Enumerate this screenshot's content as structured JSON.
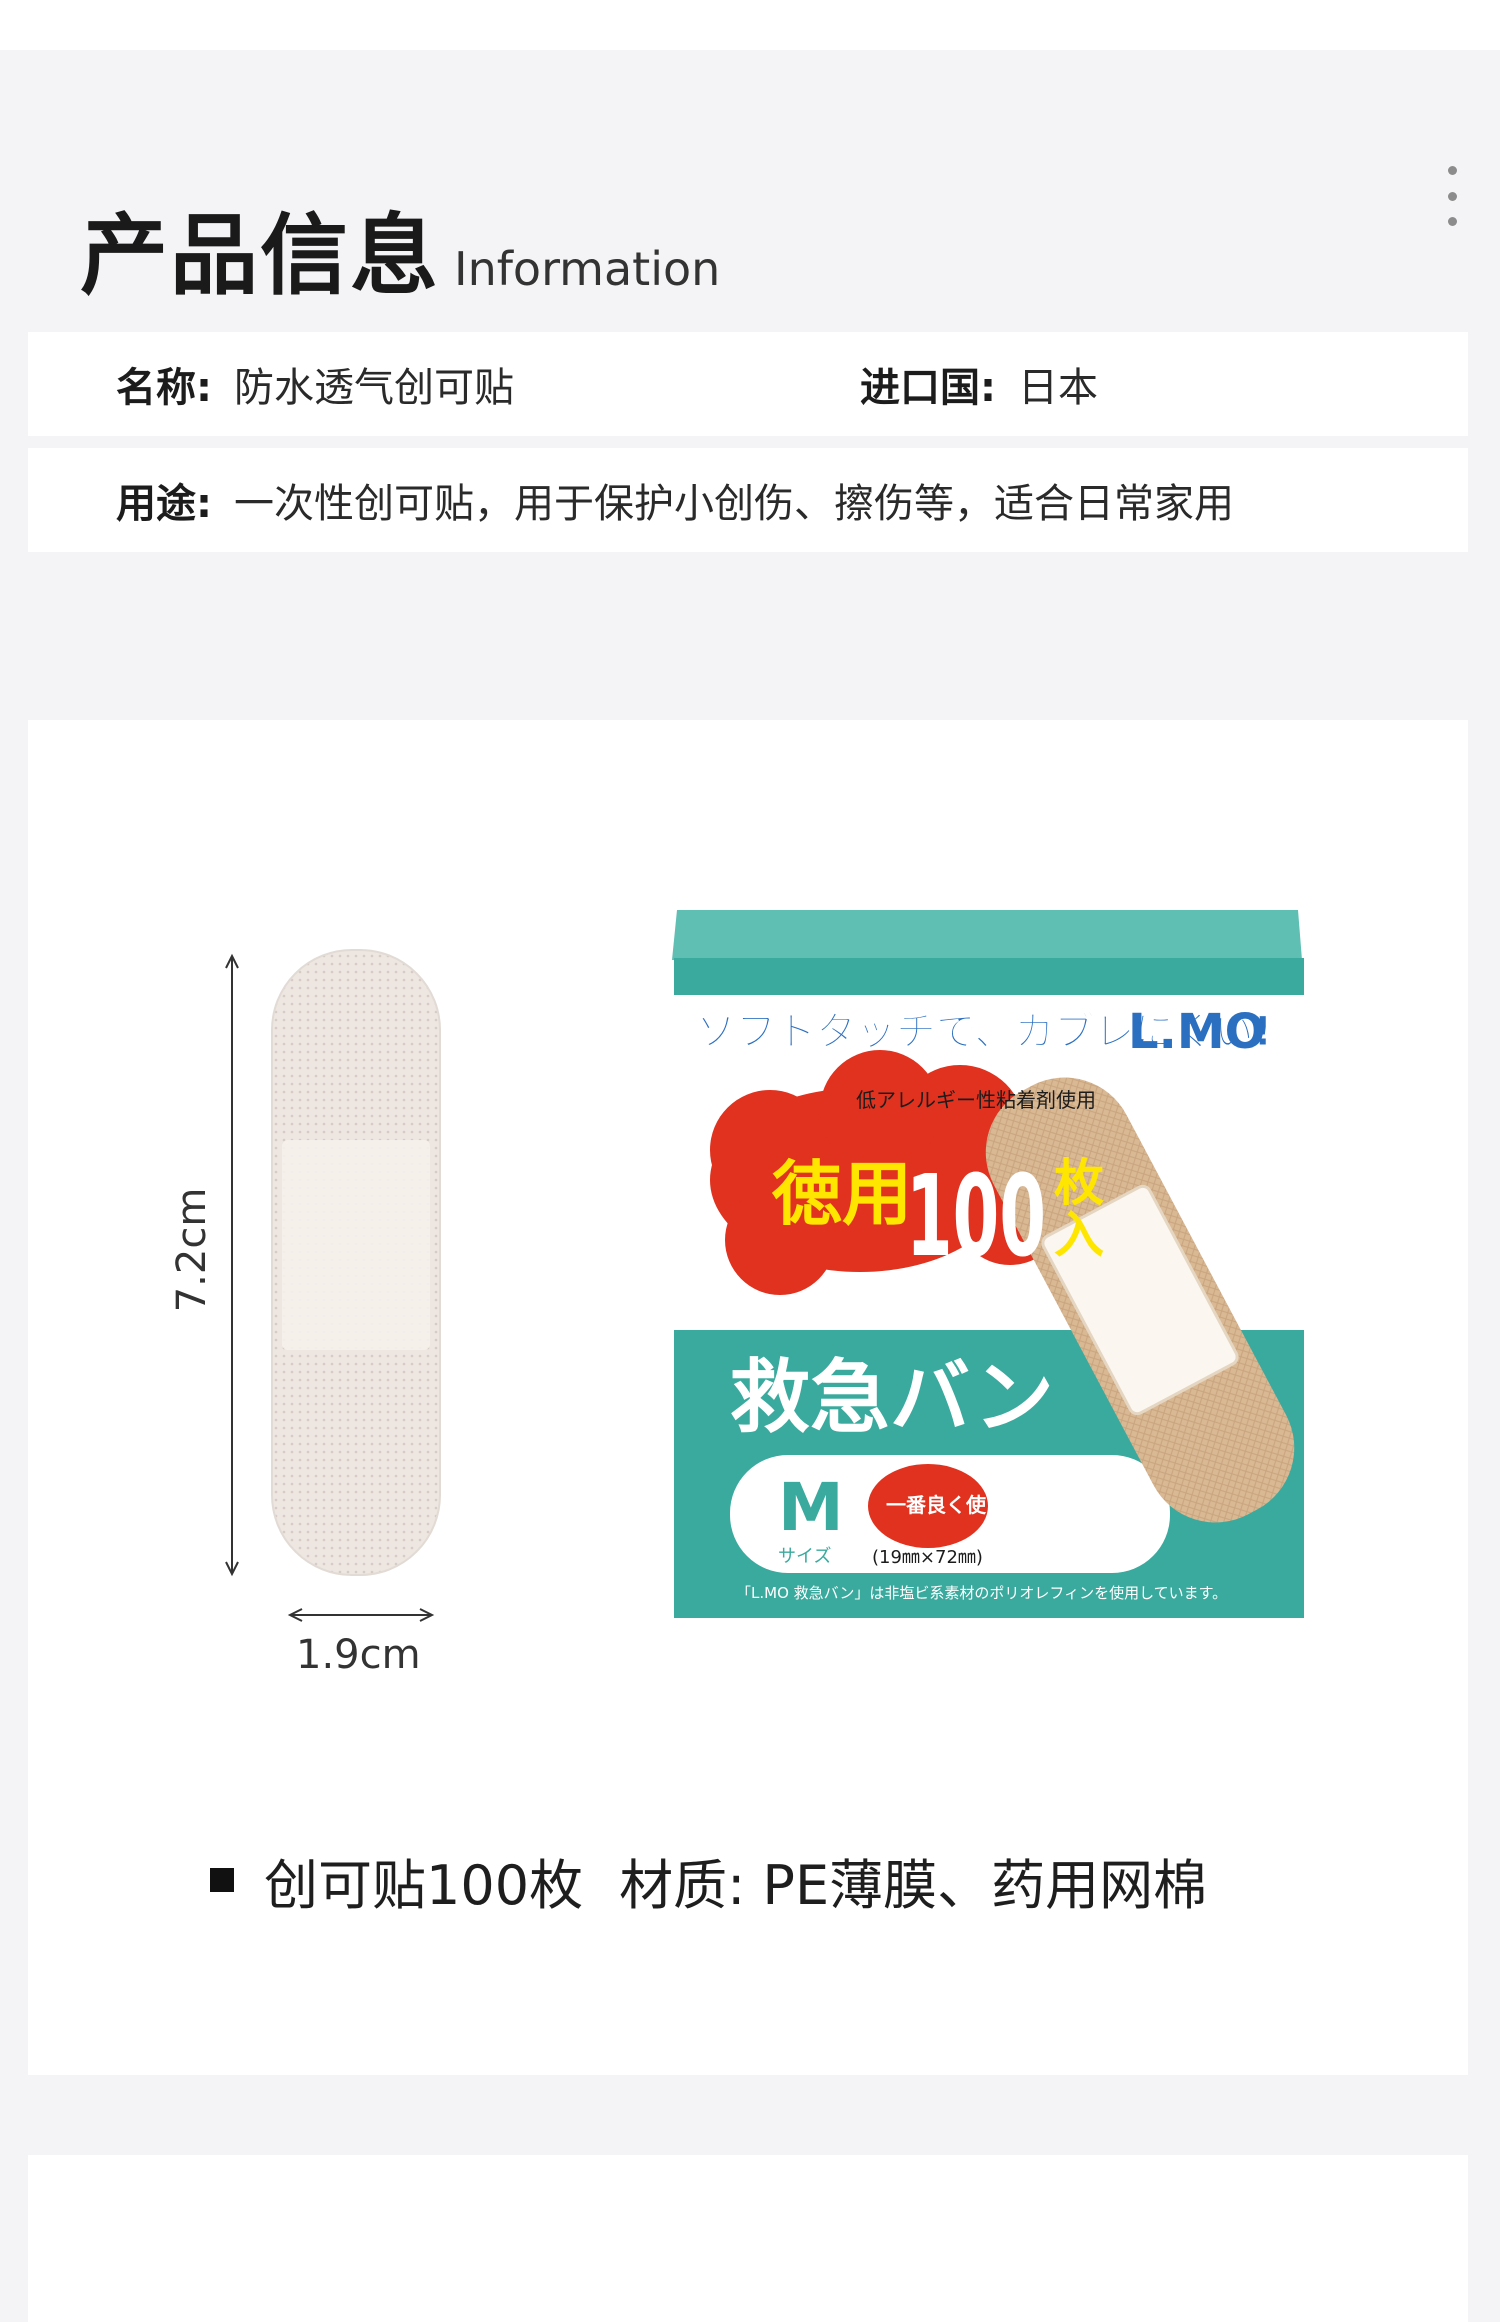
{
  "header": {
    "title": "产品信息",
    "subtitle": "Information"
  },
  "info": {
    "name_label": "名称:",
    "name_value": "防水透气创可贴",
    "origin_label": "进口国:",
    "origin_value": "日本",
    "usage_label": "用途:",
    "usage_value": "一次性创可贴，用于保护小创伤、擦伤等，适合日常家用"
  },
  "dimensions": {
    "length": "7.2cm",
    "width": "1.9cm"
  },
  "package": {
    "top_banner": "ソフトタッチで、カブレにくい!",
    "brand": "L.MO",
    "allergy_note": "低アレルギー性粘着剤使用",
    "count_text_1": "徳用",
    "count_text_2": "100",
    "count_text_3": "枚",
    "count_text_4": "入",
    "product_name": "救急バン",
    "size_letter": "M",
    "size_word": "サイズ",
    "callout": "一番良く使う!",
    "size_spec": "(19㎜×72㎜)",
    "footer_note": "「L.MO 救急バン」は非塩ビ系素材のポリオレフィンを使用しています。"
  },
  "caption": {
    "count": "创可贴100枚",
    "material": "材质: PE薄膜、药用网棉"
  },
  "colors": {
    "background": "#f4f4f6",
    "teal": "#3aaa9e",
    "red": "#e0321f",
    "yellow": "#ffe600",
    "bandage": "#d9b894"
  }
}
